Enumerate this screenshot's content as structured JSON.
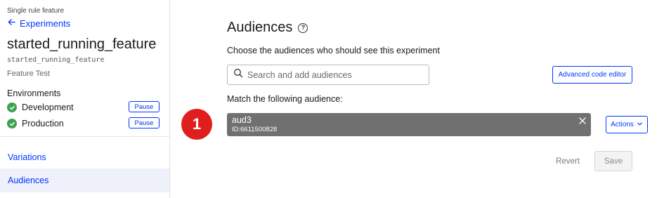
{
  "sidebar": {
    "crumb_small": "Single rule feature",
    "back_link": "Experiments",
    "feature_title": "started_running_feature",
    "feature_key": "started_running_feature",
    "feature_type": "Feature Test",
    "environments_heading": "Environments",
    "environments": [
      {
        "name": "Development",
        "status": "running",
        "action_label": "Pause"
      },
      {
        "name": "Production",
        "status": "running",
        "action_label": "Pause"
      }
    ],
    "nav": [
      {
        "label": "Variations",
        "active": false
      },
      {
        "label": "Audiences",
        "active": true
      }
    ]
  },
  "main": {
    "title": "Audiences",
    "help_icon": "?",
    "subtitle": "Choose the audiences who should see this experiment",
    "search_placeholder": "Search and add audiences",
    "advanced_button": "Advanced code editor",
    "match_label": "Match the following audience:",
    "step_badge": "1",
    "audience": {
      "name": "aud3",
      "id_label": "ID:6611500828"
    },
    "actions_button": "Actions",
    "revert_button": "Revert",
    "save_button": "Save"
  },
  "icons": {
    "back": "arrow-left-icon",
    "check": "check-circle-icon",
    "search": "search-icon",
    "close": "close-icon",
    "chevron": "chevron-down-icon",
    "help": "help-circle-icon"
  },
  "colors": {
    "link_blue": "#0037ff",
    "success_green": "#3fa34d",
    "badge_red": "#e01e1e",
    "chip_gray": "#707070",
    "active_nav_bg": "#eef1f9"
  }
}
